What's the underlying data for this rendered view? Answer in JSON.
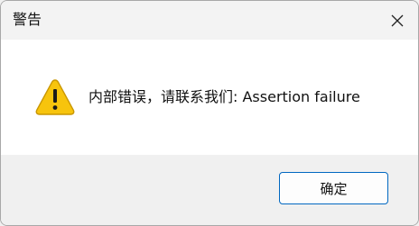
{
  "dialog": {
    "title": "警告",
    "message": "内部错误，请联系我们: Assertion failure",
    "ok_label": "确定",
    "icon": "warning-icon",
    "close_icon": "close-icon"
  },
  "colors": {
    "warning_fill": "#f7c40d",
    "accent_border": "#0067c0",
    "content_bg": "#ffffff",
    "footer_bg": "#f0f0f0"
  }
}
